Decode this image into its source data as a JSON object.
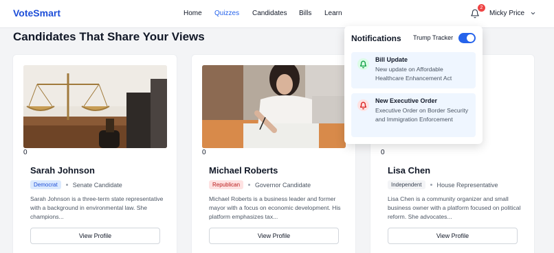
{
  "app": {
    "brand": "VoteSmart"
  },
  "nav": {
    "items": [
      "Home",
      "Quizzes",
      "Candidates",
      "Bills",
      "Learn"
    ],
    "active": "Quizzes"
  },
  "header": {
    "notification_count": "2",
    "user_name": "Micky Price"
  },
  "page": {
    "title": "Candidates That Share Your Views"
  },
  "candidates": [
    {
      "score": "0",
      "name": "Sarah Johnson",
      "party": "Democrat",
      "party_color": "#1d4ed8",
      "party_bg": "#dbeafe",
      "role": "Senate Candidate",
      "description": "Sarah Johnson is a three-term state representative with a background in environmental law. She champions...",
      "button": "View Profile",
      "image_icon": "scales-of-justice-photo"
    },
    {
      "score": "0",
      "name": "Michael Roberts",
      "party": "Republican",
      "party_color": "#b91c1c",
      "party_bg": "#fee2e2",
      "role": "Governor Candidate",
      "description": "Michael Roberts is a business leader and former mayor with a focus on economic development. His platform emphasizes tax...",
      "button": "View Profile",
      "image_icon": "person-writing-photo"
    },
    {
      "score": "0",
      "name": "Lisa Chen",
      "party": "Independent",
      "party_color": "#374151",
      "party_bg": "#f3f4f6",
      "role": "House Representative",
      "description": "Lisa Chen is a community organizer and small business owner with a platform focused on political reform. She advocates...",
      "button": "View Profile",
      "image_icon": "hidden-behind-panel"
    }
  ],
  "notifications": {
    "title": "Notifications",
    "toggle_label": "Trump Tracker",
    "toggle_on": true,
    "items": [
      {
        "title": "Bill Update",
        "text": "New update on Affordable Healthcare Enhancement Act",
        "icon": "bell-icon",
        "icon_color": "#16a34a",
        "icon_bg": "#dcfce7"
      },
      {
        "title": "New Executive Order",
        "text": "Executive Order on Border Security and Immigration Enforcement",
        "icon": "bell-icon",
        "icon_color": "#dc2626",
        "icon_bg": "#fee2e2"
      }
    ]
  }
}
